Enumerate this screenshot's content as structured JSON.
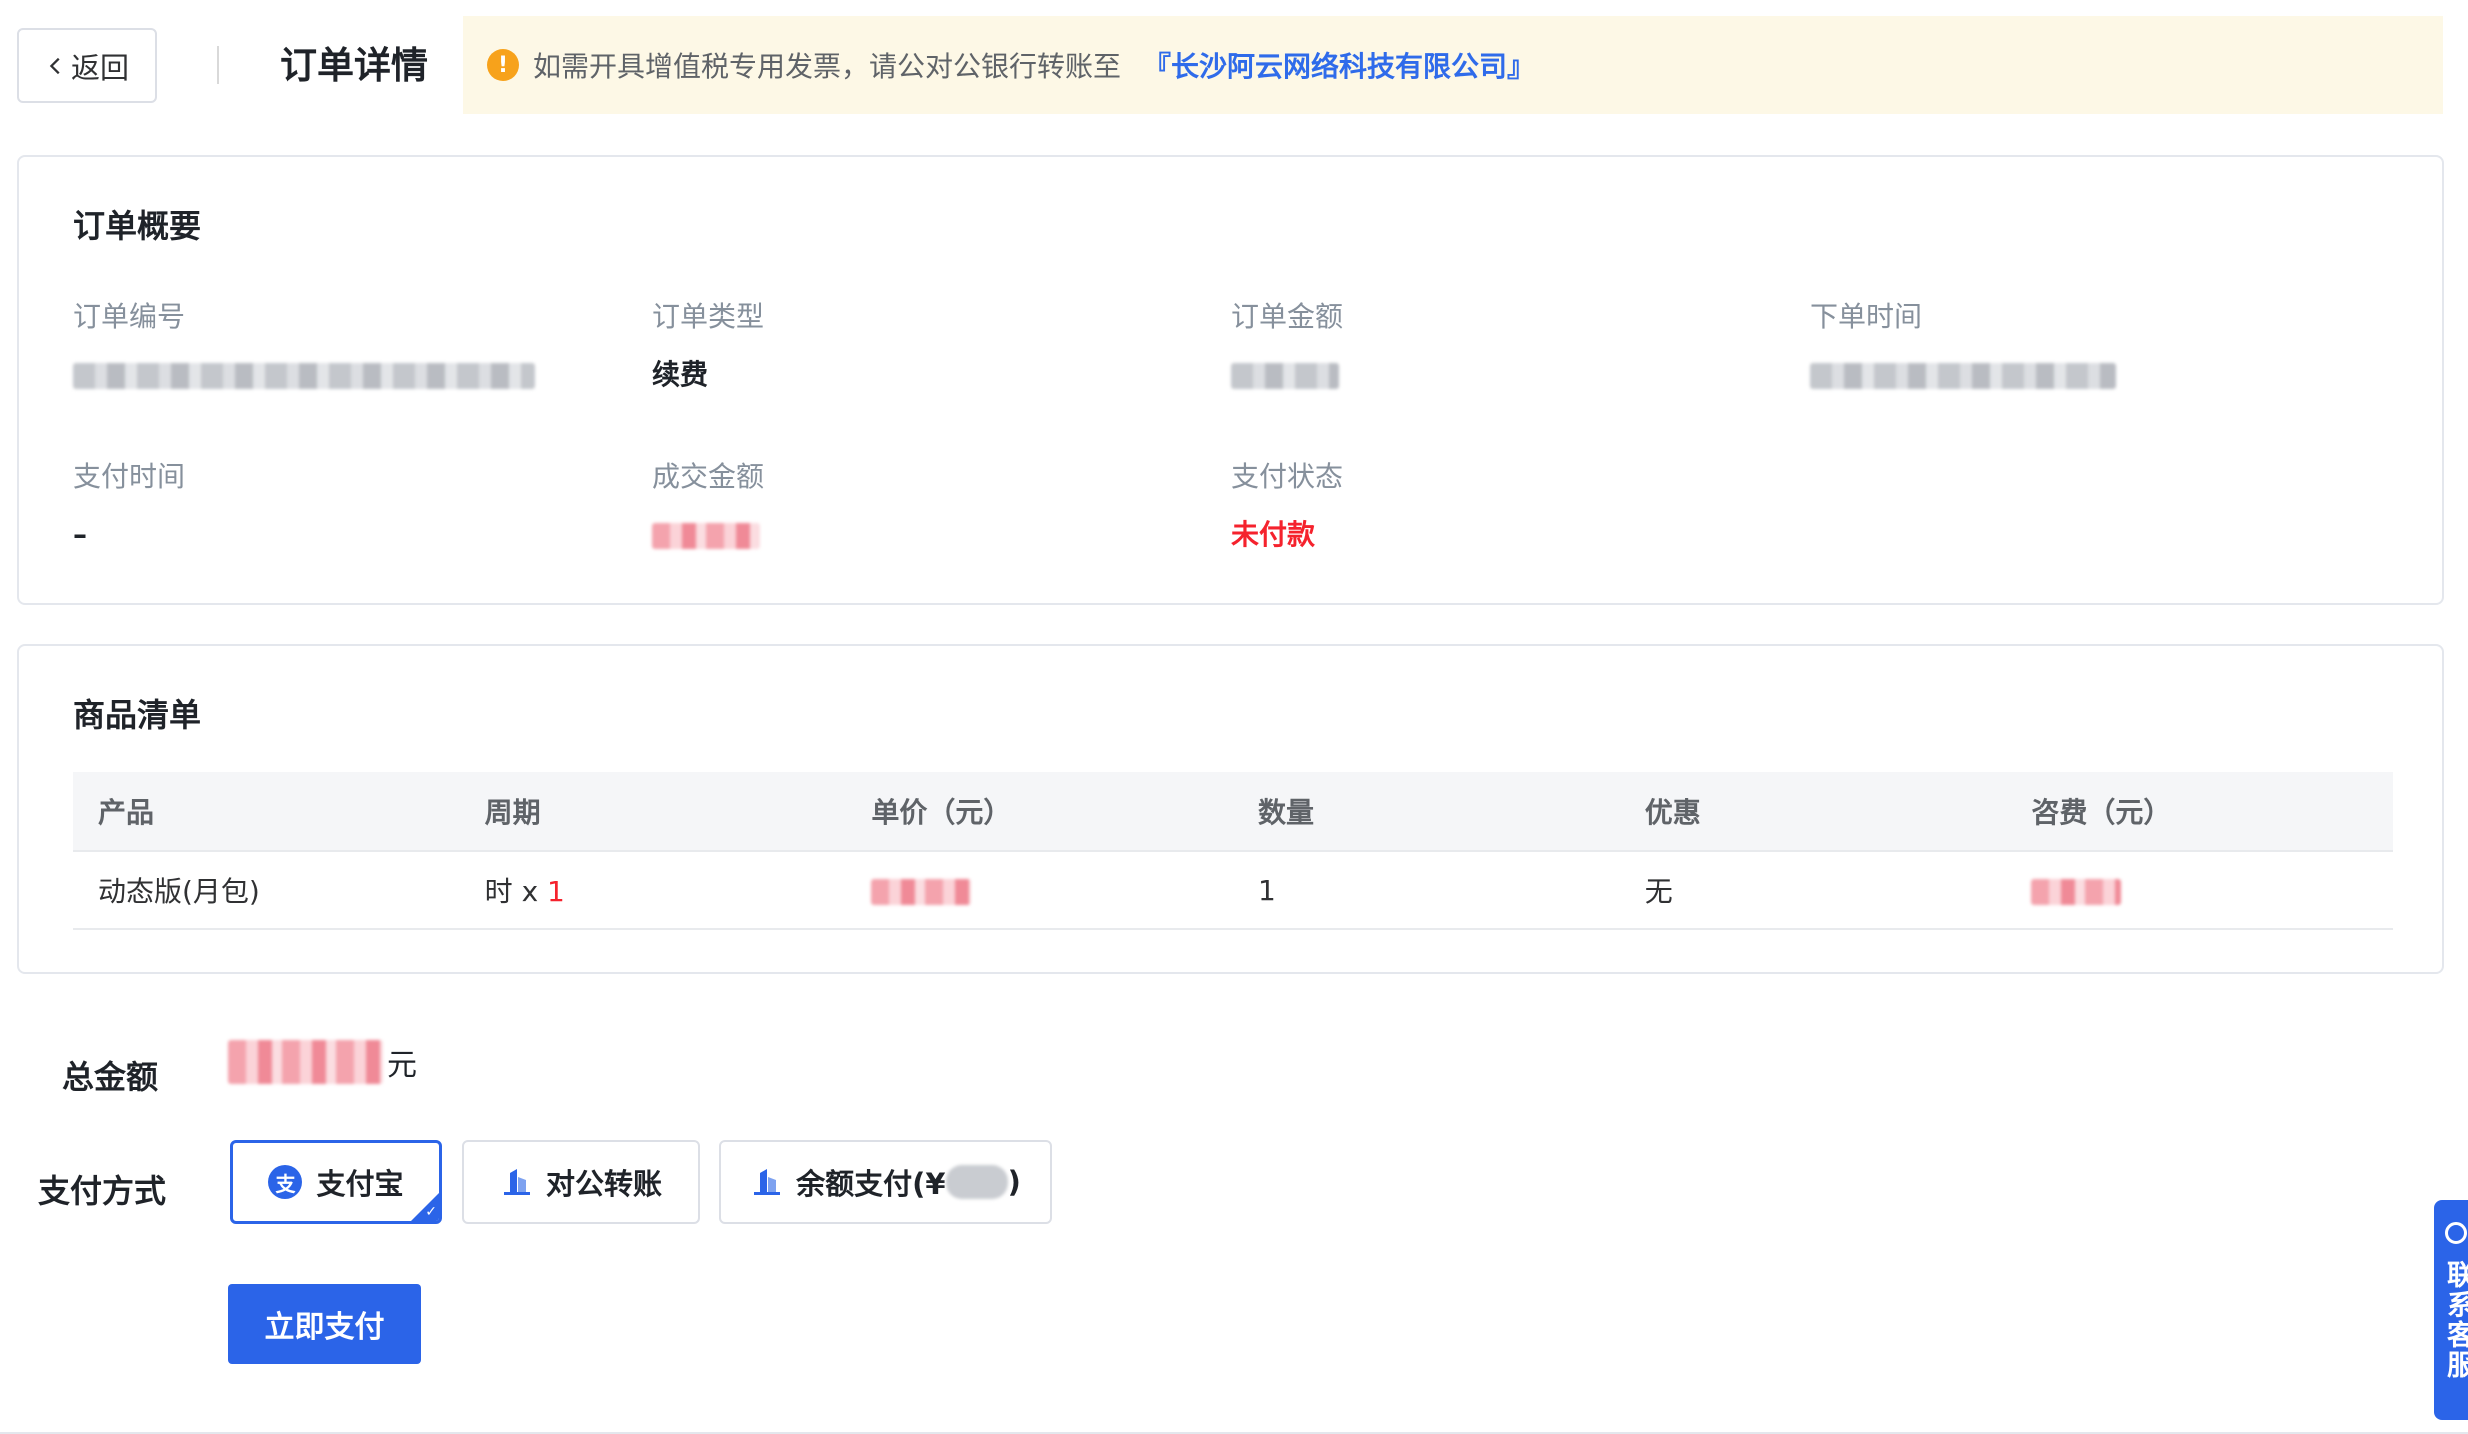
{
  "header": {
    "back_label": "返回",
    "title": "订单详情",
    "notice_text": "如需开具增值税专用发票，请公对公银行转账至",
    "notice_company": "『长沙阿云网络科技有限公司』",
    "warn_icon": "info-icon",
    "colors": {
      "notice_bg": "#fdf8e6",
      "link": "#2f6bea",
      "warn": "#f7a21b"
    }
  },
  "summary": {
    "title": "订单概要",
    "order_no_label": "订单编号",
    "order_type_label": "订单类型",
    "order_type_value": "续费",
    "order_amount_label": "订单金额",
    "order_time_label": "下单时间",
    "pay_time_label": "支付时间",
    "pay_time_value": "–",
    "deal_amount_label": "成交金额",
    "pay_status_label": "支付状态",
    "pay_status_value": "未付款"
  },
  "goods": {
    "title": "商品清单",
    "columns": [
      "产品",
      "周期",
      "单价（元）",
      "数量",
      "优惠",
      "咨费（元）"
    ],
    "row": {
      "product": "动态版(月包)",
      "period_unit": "时 x ",
      "period_qty": "1",
      "quantity": "1",
      "discount": "无"
    }
  },
  "payment": {
    "total_label": "总金额",
    "total_unit": "元",
    "method_label": "支付方式",
    "methods": [
      {
        "label": "支付宝",
        "icon": "alipay-icon",
        "selected": true
      },
      {
        "label": "对公转账",
        "icon": "bank-icon",
        "selected": false
      },
      {
        "label": "余额支付(¥",
        "suffix": ")",
        "icon": "bank-icon",
        "selected": false
      }
    ],
    "pay_button": "立即支付"
  },
  "service": {
    "label": "联系客服",
    "icon": "headset-icon"
  },
  "colors": {
    "primary": "#2b64e8",
    "danger": "#f5222d",
    "border": "#e4e7ed"
  }
}
